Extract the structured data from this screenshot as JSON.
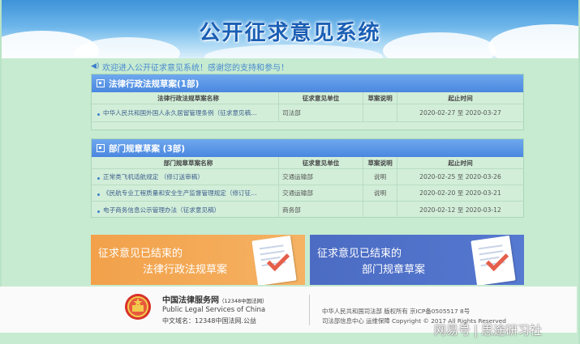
{
  "header": {
    "title": "公开征求意见系统"
  },
  "welcome": "欢迎进入公开征求意见系统！感谢您的支持和参与！",
  "sections": [
    {
      "title": "法律行政法规草案(1部)",
      "columns": [
        "法律行政法规草案名称",
        "征求意见单位",
        "草案说明",
        "起止时间"
      ],
      "rows": [
        {
          "name": "中华人民共和国外国人永久居留管理条例（征求意见稿...",
          "unit": "司法部",
          "note": "",
          "period": "2020-02-27 至 2020-03-27"
        }
      ]
    },
    {
      "title": "部门规章草案 (3部)",
      "columns": [
        "部门规章草案名称",
        "征求意见单位",
        "草案说明",
        "起止时间"
      ],
      "rows": [
        {
          "name": "正常类飞机适航规定 （修订送审稿）",
          "unit": "交通运输部",
          "note": "说明",
          "period": "2020-02-25 至 2020-03-26"
        },
        {
          "name": "《民航专业工程质量和安全生产监督管理规定（修订征...",
          "unit": "交通运输部",
          "note": "说明",
          "period": "2020-02-20 至 2020-03-21"
        },
        {
          "name": "电子商务信息公示管理办法（征求意见稿）",
          "unit": "商务部",
          "note": "",
          "period": "2020-02-12 至 2020-03-12"
        }
      ]
    }
  ],
  "promos": [
    {
      "line1": "征求意见已结束的",
      "line2": "法律行政法规草案",
      "color": "#f2a14a"
    },
    {
      "line1": "征求意见已结束的",
      "line2": "部门规章草案",
      "color": "#4c6cc3"
    }
  ],
  "footer": {
    "name_cn": "中国法律服务网",
    "name_cn_small": "（12348中国法网）",
    "name_en": "Public Legal Services of China",
    "domain": "中文域名：12348中国法网.公益",
    "right1": "中华人民共和国司法部 版权所有 京ICP备0505517 8号",
    "right2": "司法部信息中心 运维保障   Copyright © 2017 All Rights Reserved"
  },
  "watermark": {
    "brand": "网易号",
    "author": "思途研习社"
  },
  "icons": [
    "speaker-icon",
    "document-icon",
    "emblem-icon",
    "doc-check-icon"
  ]
}
